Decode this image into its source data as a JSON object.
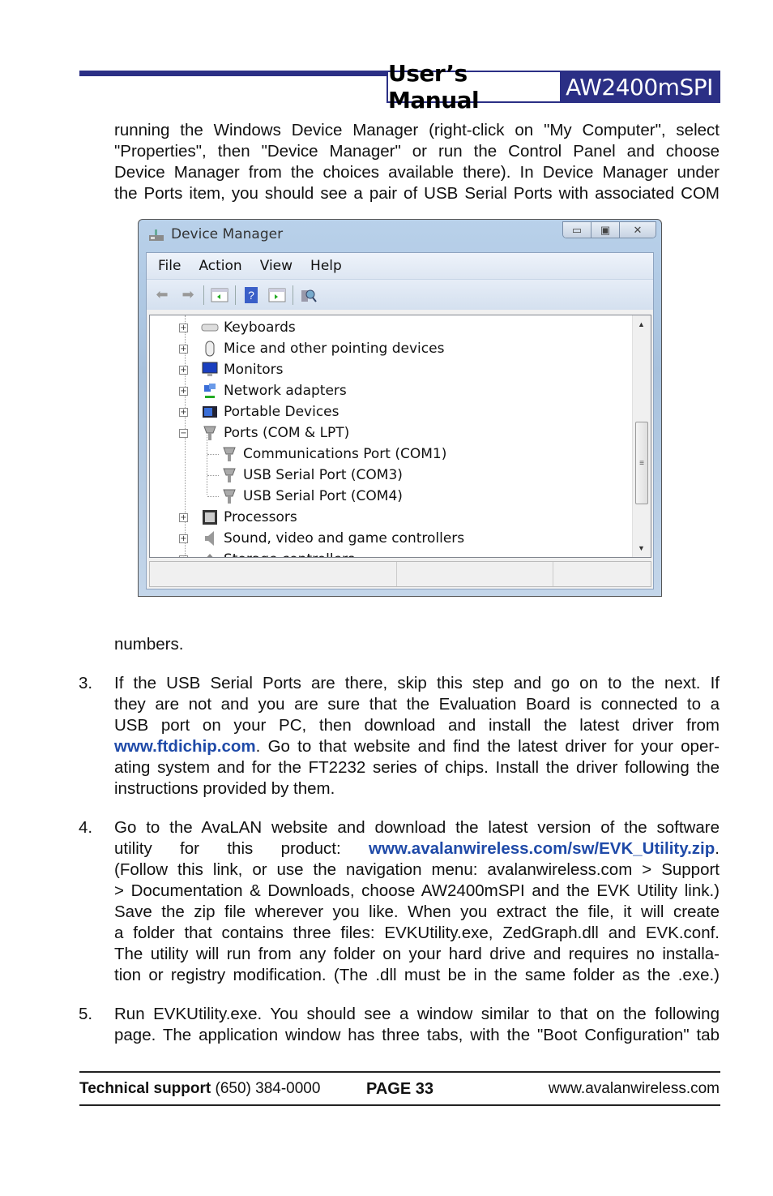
{
  "header": {
    "title": "User’s Manual",
    "product": "AW2400mSPI",
    "accent_color": "#2b2f85"
  },
  "intro": {
    "lines": [
      "running the Windows Device Manager (right-click on \"My Computer\", select",
      "\"Properties\", then \"Device Manager\" or run the Control Panel and choose",
      "Device Manager from the choices available there). In Device Manager under",
      "the Ports item, you should see a pair of USB Serial Ports with associated COM"
    ],
    "after": "numbers."
  },
  "window": {
    "title": "Device Manager",
    "menu": [
      "File",
      "Action",
      "View",
      "Help"
    ],
    "toolbar_icons": [
      "back-arrow-icon",
      "forward-arrow-icon",
      "show-hide-console-tree-icon",
      "help-icon",
      "show-action-pane-icon",
      "scan-hardware-icon"
    ],
    "tree": [
      {
        "label": "Keyboards",
        "icon": "keyboard-icon",
        "expander": "+"
      },
      {
        "label": "Mice and other pointing devices",
        "icon": "mouse-icon",
        "expander": "+"
      },
      {
        "label": "Monitors",
        "icon": "monitor-icon",
        "expander": "+"
      },
      {
        "label": "Network adapters",
        "icon": "network-icon",
        "expander": "+"
      },
      {
        "label": "Portable Devices",
        "icon": "portable-device-icon",
        "expander": "+"
      },
      {
        "label": "Ports (COM & LPT)",
        "icon": "port-icon",
        "expander": "-",
        "children": [
          "Communications Port (COM1)",
          "USB Serial Port (COM3)",
          "USB Serial Port (COM4)"
        ]
      },
      {
        "label": "Processors",
        "icon": "processor-icon",
        "expander": "+"
      },
      {
        "label": "Sound, video and game controllers",
        "icon": "speaker-icon",
        "expander": "+"
      },
      {
        "label": "Storage controllers",
        "icon": "storage-icon",
        "expander": "+"
      }
    ]
  },
  "steps": [
    {
      "number": "3.",
      "lines": [
        "If the USB Serial Ports are there, skip this step and go on to the next. If",
        "they are not and you are sure that the Evaluation Board is connected to a",
        "USB port on your PC, then download and install the latest driver from"
      ],
      "link": "www.ftdichip.com",
      "link_rest": ". Go to that website and find the latest driver for your oper-",
      "lines2": [
        "ating system and for the FT2232 series of chips. Install the driver following the",
        "instructions provided by them."
      ]
    },
    {
      "number": "4.",
      "line1": "Go to the AvaLAN website and download the latest version of the software",
      "line2_pre": "utility   for   this   product:",
      "link": "www.avalanwireless.com/sw/EVK_Utility.zip",
      "link_after": ".",
      "lines": [
        "(Follow this link, or use the navigation menu: avalanwireless.com > Support",
        "> Documentation & Downloads, choose AW2400mSPI and the EVK Utility link.)",
        "Save the zip file wherever you like. When you extract the file, it will create",
        "a folder that contains three files: EVKUtility.exe, ZedGraph.dll and EVK.conf.",
        "The utility will run from any folder on your hard drive and requires no installa-",
        "tion or registry modification. (The .dll must be in the same folder as the .exe.)"
      ]
    },
    {
      "number": "5.",
      "lines": [
        "Run EVKUtility.exe. You should see a window similar to that on the following",
        "page. The application window has three tabs, with the \"Boot Configuration\" tab"
      ]
    }
  ],
  "footer": {
    "support_label": "Technical support",
    "support_phone": "(650) 384-0000",
    "page": "PAGE 33",
    "website": "www.avalanwireless.com"
  }
}
